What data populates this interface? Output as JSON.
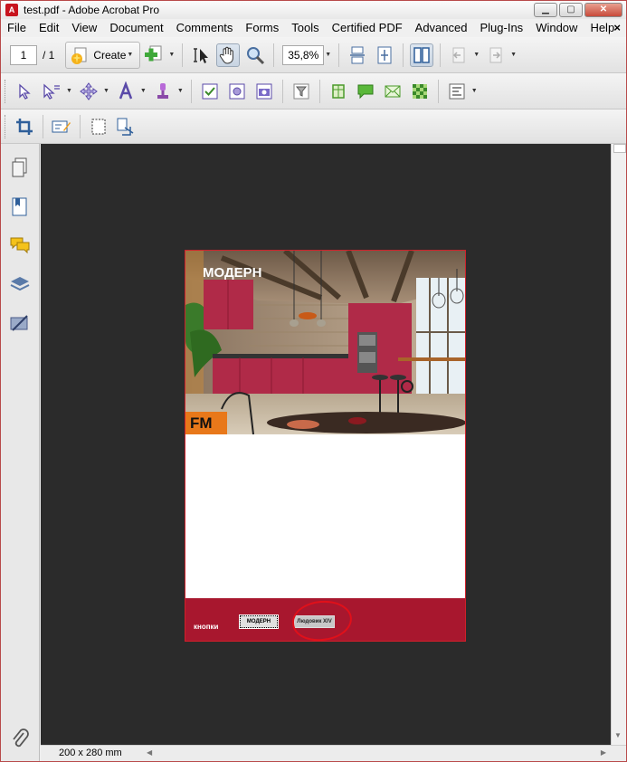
{
  "window": {
    "title": "test.pdf - Adobe Acrobat Pro",
    "minimize_icon": "minimize-icon",
    "maximize_icon": "maximize-icon",
    "close_icon": "close-icon"
  },
  "menubar": {
    "items": [
      "File",
      "Edit",
      "View",
      "Document",
      "Comments",
      "Forms",
      "Tools",
      "Certified PDF",
      "Advanced",
      "Plug-Ins",
      "Window",
      "Help"
    ],
    "close_glyph": "×"
  },
  "toolbar1": {
    "current_page": "1",
    "total_pages": "/ 1",
    "create_label": "Create",
    "zoom_value": "35,8%"
  },
  "document": {
    "title": "МОДЕРН",
    "logo": "FM",
    "footer_label": "кнопки",
    "button_modern": "МОДЕРН",
    "button_louis": "Людовик XIV"
  },
  "statusbar": {
    "page_size": "200 x 280 mm"
  },
  "colors": {
    "accent_red": "#a8172e",
    "annotation_red": "#e0101a",
    "logo_orange": "#e8781a",
    "doc_background": "#2b2b2b"
  }
}
